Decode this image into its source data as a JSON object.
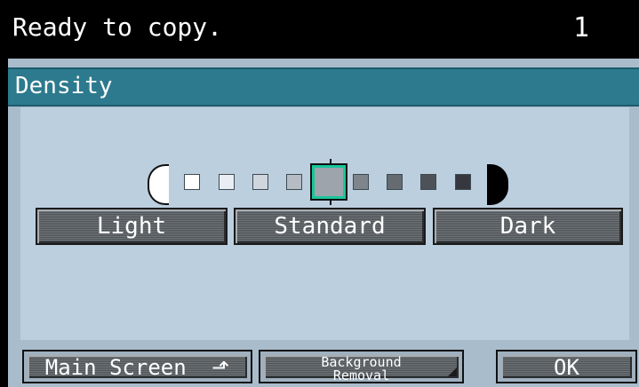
{
  "status": {
    "message": "Ready to copy.",
    "copy_count": "1"
  },
  "panel": {
    "title": "Density"
  },
  "density": {
    "levels": [
      {
        "color": "#ffffff"
      },
      {
        "color": "#e9eef4"
      },
      {
        "color": "#cfd6de"
      },
      {
        "color": "#b6bcc3"
      },
      {
        "color": "#9ea4ab",
        "current": true
      },
      {
        "color": "#7f858c"
      },
      {
        "color": "#666b72"
      },
      {
        "color": "#4d5258"
      },
      {
        "color": "#35393f"
      }
    ],
    "light_label": "Light",
    "standard_label": "Standard",
    "dark_label": "Dark"
  },
  "footer": {
    "main_screen_label": "Main Screen",
    "background_removal_line1": "Background",
    "background_removal_line2": "Removal",
    "ok_label": "OK"
  },
  "colors": {
    "panel_header": "#2d7a8e",
    "panel_bg": "#a9bccb",
    "selected_outline": "#19c59a"
  }
}
